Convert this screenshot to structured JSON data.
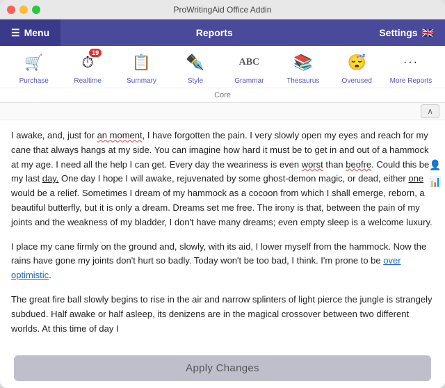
{
  "window": {
    "title": "ProWritingAid Office Addin"
  },
  "nav": {
    "menu_label": "Menu",
    "reports_label": "Reports",
    "settings_label": "Settings",
    "settings_flag": "🇬🇧"
  },
  "toolbar": {
    "items": [
      {
        "id": "purchase",
        "label": "Purchase",
        "icon": "🛒",
        "badge": null
      },
      {
        "id": "realtime",
        "label": "Realtime",
        "icon": "⏱",
        "badge": "19"
      },
      {
        "id": "summary",
        "label": "Summary",
        "icon": "📋",
        "badge": null
      },
      {
        "id": "style",
        "label": "Style",
        "icon": "✏",
        "badge": null
      },
      {
        "id": "grammar",
        "label": "Grammar",
        "icon": "ABC",
        "badge": null
      },
      {
        "id": "thesaurus",
        "label": "Thesaurus",
        "icon": "📖",
        "badge": null
      },
      {
        "id": "overused",
        "label": "Overused",
        "icon": "😴",
        "badge": null
      },
      {
        "id": "more",
        "label": "More Reports",
        "icon": "•••",
        "badge": null
      }
    ],
    "core_label": "Core"
  },
  "content": {
    "paragraph1": "I awake, and, just for an moment, I have forgotten the pain. I very slowly open my eyes and reach for my cane that always hangs at my side. You can imagine how hard it must be to get in and out of a hammock at my age. I need all the help I can get. Every day the weariness is even worst than beofre. Could this be my last day. One day I hope I will awake, rejuvenated by some ghost-demon magic, or dead, either one would be a relief. Sometimes I dream of my hammock as a cocoon from which I shall emerge, reborn, a beautiful butterfly, but it is only a dream. Dreams set me free. The irony is that, between the pain of my joints and the weakness of my bladder, I don't have many dreams; even empty sleep is a welcome luxury.",
    "paragraph2": "I place my cane firmly on the ground and, slowly, with its aid, I lower myself from the hammock. Now the rains have gone my joints don't hurt so badly. Today won't be too bad, I think. I'm prone to be over optimistic.",
    "paragraph3": "The great fire ball slowly begins to rise in the air and narrow splinters of light pierce the jungle is strangely subdued. Half awake or half asleep, its denizens are in the magical crossover between two different worlds. At this time of day I"
  },
  "apply_button": {
    "label": "Apply Changes"
  }
}
